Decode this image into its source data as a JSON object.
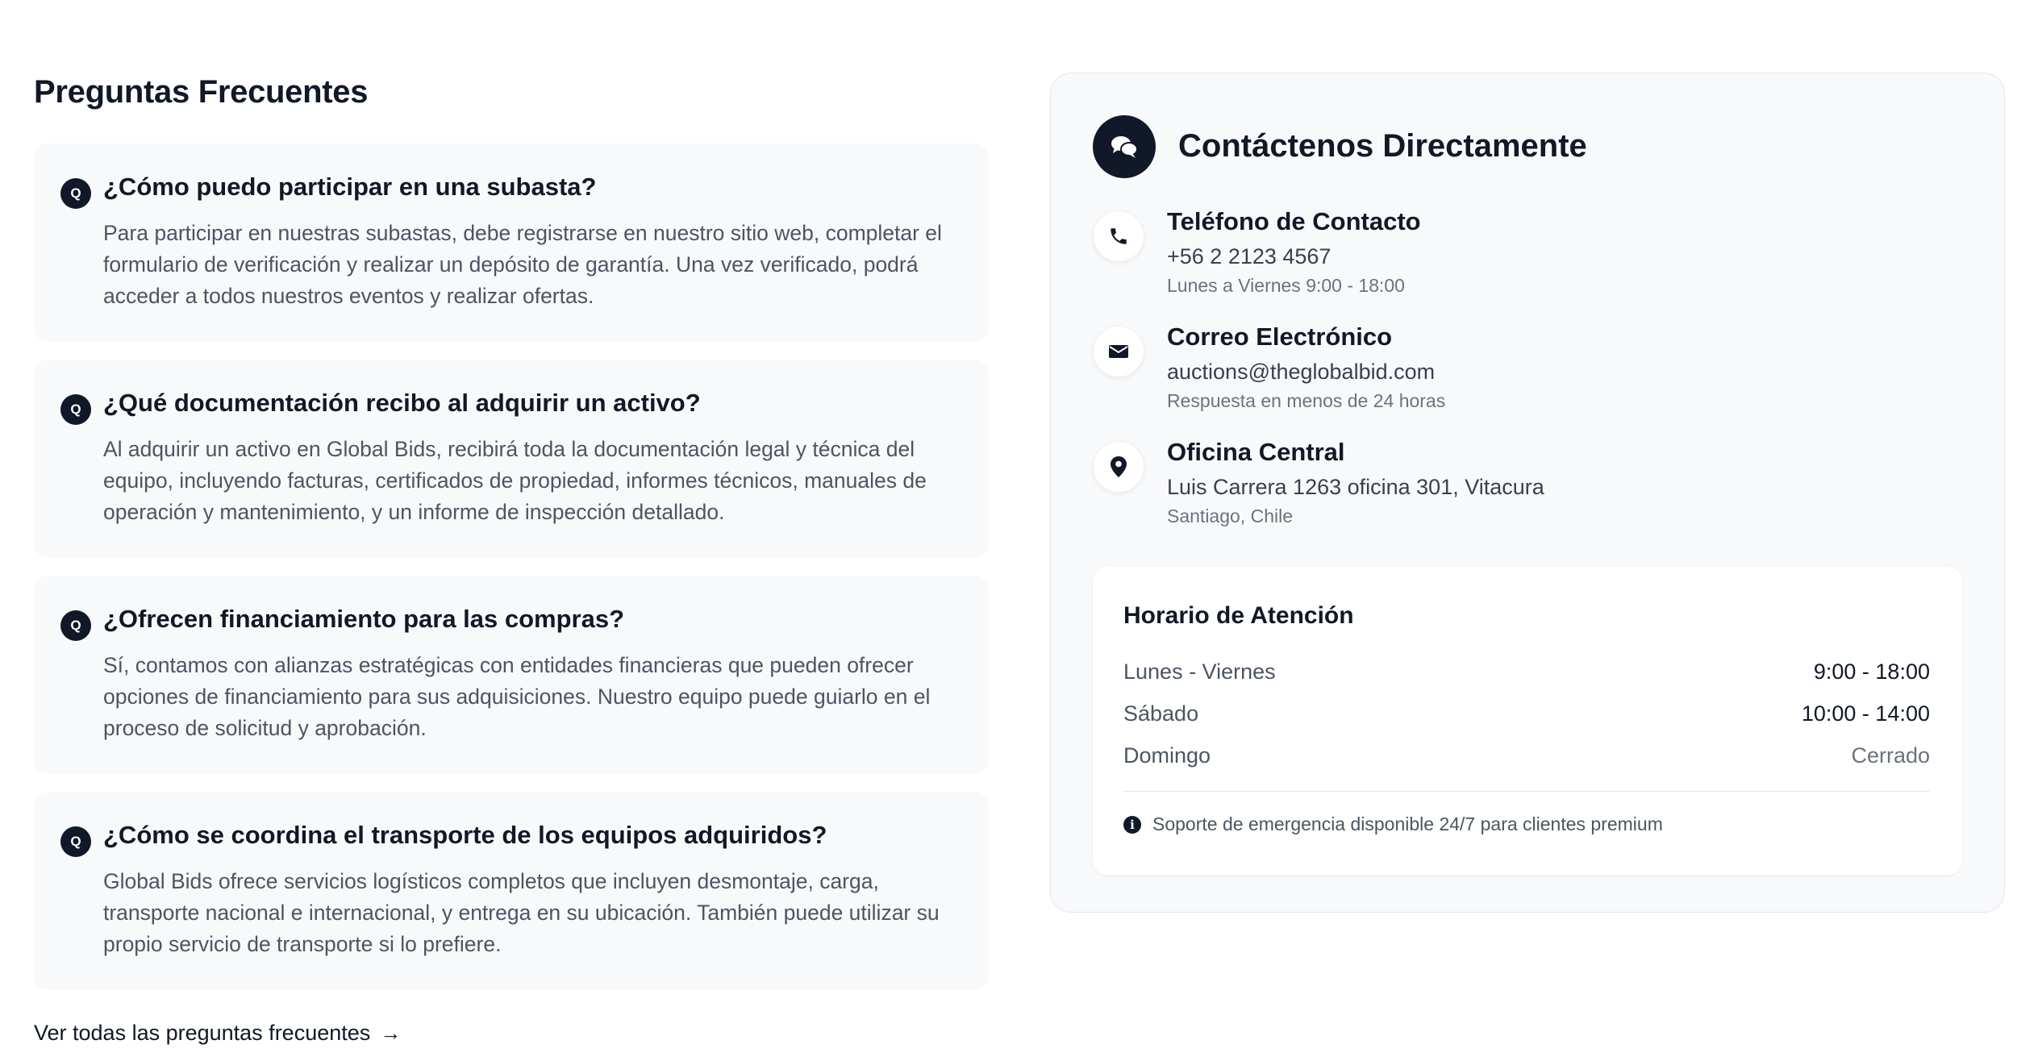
{
  "faq": {
    "title": "Preguntas Frecuentes",
    "q_badge": "Q",
    "items": [
      {
        "question": "¿Cómo puedo participar en una subasta?",
        "answer": "Para participar en nuestras subastas, debe registrarse en nuestro sitio web, completar el formulario de verificación y realizar un depósito de garantía. Una vez verificado, podrá acceder a todos nuestros eventos y realizar ofertas."
      },
      {
        "question": "¿Qué documentación recibo al adquirir un activo?",
        "answer": "Al adquirir un activo en Global Bids, recibirá toda la documentación legal y técnica del equipo, incluyendo facturas, certificados de propiedad, informes técnicos, manuales de operación y mantenimiento, y un informe de inspección detallado."
      },
      {
        "question": "¿Ofrecen financiamiento para las compras?",
        "answer": "Sí, contamos con alianzas estratégicas con entidades financieras que pueden ofrecer opciones de financiamiento para sus adquisiciones. Nuestro equipo puede guiarlo en el proceso de solicitud y aprobación."
      },
      {
        "question": "¿Cómo se coordina el transporte de los equipos adquiridos?",
        "answer": "Global Bids ofrece servicios logísticos completos que incluyen desmontaje, carga, transporte nacional e internacional, y entrega en su ubicación. También puede utilizar su propio servicio de transporte si lo prefiere."
      }
    ],
    "view_all_label": "Ver todas las preguntas frecuentes",
    "view_all_arrow": "→"
  },
  "contact": {
    "title": "Contáctenos Directamente",
    "head_icon": "chat-bubbles-icon",
    "items": [
      {
        "icon": "phone-icon",
        "label": "Teléfono de Contacto",
        "value": "+56 2 2123 4567",
        "sub": "Lunes a Viernes 9:00 - 18:00"
      },
      {
        "icon": "envelope-icon",
        "label": "Correo Electrónico",
        "value": "auctions@theglobalbid.com",
        "sub": "Respuesta en menos de 24 horas"
      },
      {
        "icon": "location-pin-icon",
        "label": "Oficina Central",
        "value": "Luis Carrera 1263 oficina 301, Vitacura",
        "sub": "Santiago, Chile"
      }
    ],
    "hours": {
      "title": "Horario de Atención",
      "rows": [
        {
          "day": "Lunes - Viernes",
          "time": "9:00 - 18:00"
        },
        {
          "day": "Sábado",
          "time": "10:00 - 14:00"
        },
        {
          "day": "Domingo",
          "time": "Cerrado"
        }
      ],
      "note_icon": "info-icon",
      "note_icon_glyph": "i",
      "note": "Soporte de emergencia disponible 24/7 para clientes premium"
    }
  },
  "colors": {
    "dark": "#111827",
    "card_bg": "#f8f9fb",
    "muted_text": "#4b5563"
  }
}
